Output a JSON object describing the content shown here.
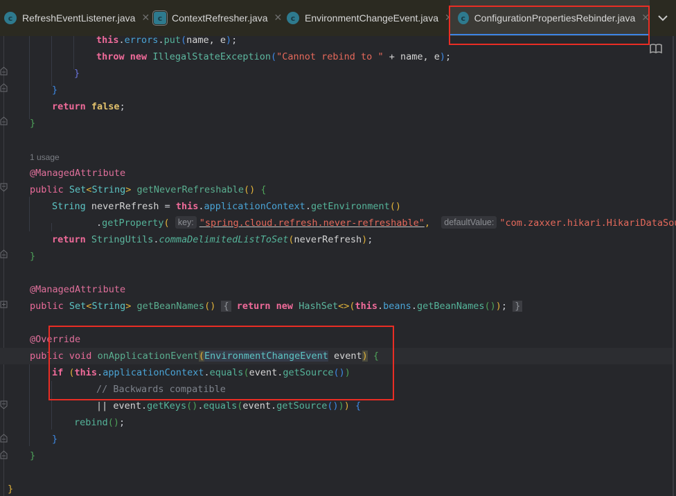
{
  "tabs": [
    {
      "label": "RefreshEventListener.java",
      "icon": "class-icon",
      "active": false
    },
    {
      "label": "ContextRefresher.java",
      "icon": "class-icon",
      "active": false
    },
    {
      "label": "EnvironmentChangeEvent.java",
      "icon": "class-icon",
      "active": false
    },
    {
      "label": "ConfigurationPropertiesRebinder.java",
      "icon": "class-icon",
      "active": true
    }
  ],
  "tab_close_glyph": "✕",
  "tabs_dropdown_glyph": "⌄",
  "code": {
    "l1": {
      "this": "this",
      "dot1": ".",
      "errors": "errors",
      "dot2": ".",
      "put": "put",
      "open": "(",
      "args": "name, e",
      "close": ")",
      "semi": ";"
    },
    "l2": {
      "throw": "throw",
      "new": "new",
      "type": "IllegalStateException",
      "open": "(",
      "str": "\"Cannot rebind to \"",
      "rest": " + name, e",
      "close": ")",
      "semi": ";"
    },
    "l3": "}",
    "l4": "}",
    "l5": {
      "return": "return",
      "false": "false",
      "semi": ";"
    },
    "l6": "}",
    "usage_hint": "1 usage",
    "ann1": "@ManagedAttribute",
    "m1": {
      "public": "public",
      "type": "Set",
      "lt": "<",
      "gen": "String",
      "gt": ">",
      "name": "getNeverRefreshable",
      "parens": "()",
      "brace": "{"
    },
    "m1_l1": {
      "type": "String",
      "var": "neverRefresh",
      "eq": " = ",
      "this": "this",
      "d1": ".",
      "fld": "applicationContext",
      "d2": ".",
      "mth": "getEnvironment",
      "parens": "()"
    },
    "m1_l2": {
      "dot": ".",
      "mth": "getProperty",
      "open": "(",
      "hint_key": "key:",
      "str1": "\"spring.cloud.refresh.never-refreshable\"",
      "comma": ",",
      "hint_default": "defaultValue:",
      "str2": "\"com.zaxxer.hikari.HikariDataSourc"
    },
    "m1_l3": {
      "return": "return",
      "cls": "StringUtils",
      "dot": ".",
      "mth": "commaDelimitedListToSet",
      "open": "(",
      "arg": "neverRefresh",
      "close": ")",
      "semi": ";"
    },
    "m1_end": "}",
    "ann2": "@ManagedAttribute",
    "m2": {
      "public": "public",
      "type": "Set",
      "lt": "<",
      "gen": "String",
      "gt": ">",
      "name": "getBeanNames",
      "parens": "()",
      "lbrace": "{",
      "return": "return",
      "new": "new",
      "cls": "HashSet",
      "diamond": "<>",
      "open": "(",
      "this": "this",
      "d1": ".",
      "fld": "beans",
      "d2": ".",
      "mth": "getBeanNames",
      "inner": "()",
      "close": ")",
      "semi": ";",
      "rbrace": "}"
    },
    "ann3": "@Override",
    "m3": {
      "public": "public",
      "void": "void",
      "name": "onApplicationEvent",
      "open": "(",
      "ptype": "EnvironmentChangeEvent",
      "pname": "event",
      "close": ")",
      "brace": "{"
    },
    "m3_l1": {
      "if": "if",
      "open": "(",
      "this": "this",
      "d1": ".",
      "fld": "applicationContext",
      "d2": ".",
      "mth": "equals",
      "o2": "(",
      "var": "event",
      "d3": ".",
      "mth2": "getSource",
      "parens": "()",
      "c2": ")"
    },
    "m3_l2": "// Backwards compatible",
    "m3_l3": {
      "or": "|| ",
      "var": "event",
      "d1": ".",
      "mth": "getKeys",
      "p1": "()",
      "d2": ".",
      "mth2": "equals",
      "o": "(",
      "var2": "event",
      "d3": ".",
      "mth3": "getSource",
      "p2": "()",
      "c1": ")",
      "c2": ")",
      "brace": "{"
    },
    "m3_l4": {
      "mth": "rebind",
      "parens": "()",
      "semi": ";"
    },
    "m3_l5": "}",
    "m3_end": "}",
    "class_end": "}"
  },
  "colors": {
    "annotation_box": "#ea2d24",
    "active_tab_underline": "#3d84e6",
    "editor_bg": "#26272b",
    "tabbar_bg": "#2b2a21"
  }
}
